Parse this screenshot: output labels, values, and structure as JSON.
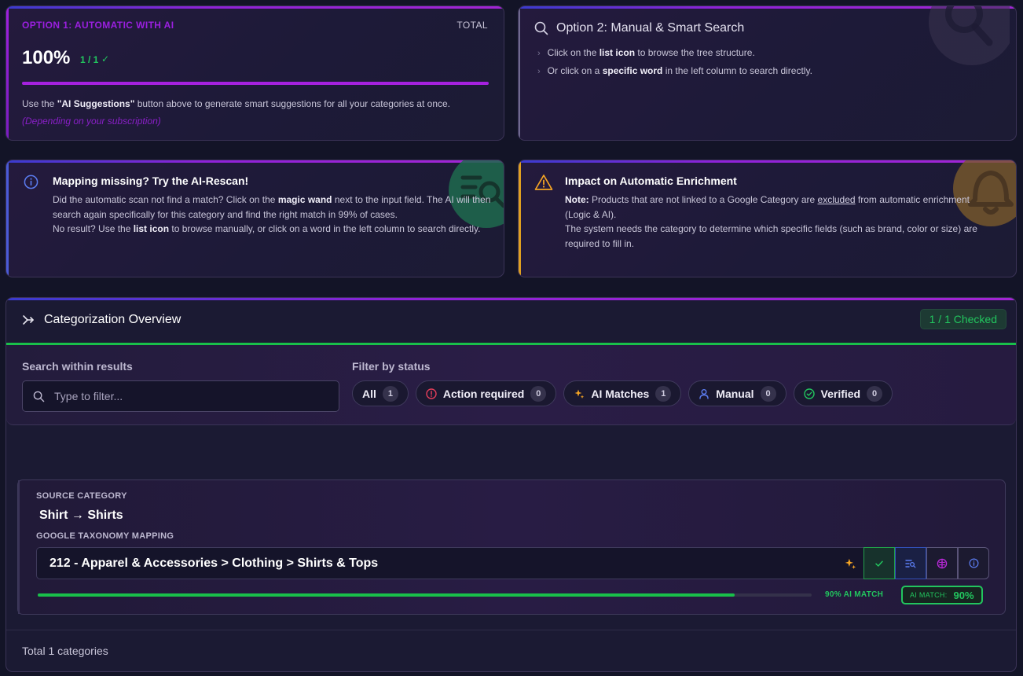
{
  "option1": {
    "title": "OPTION 1: AUTOMATIC WITH AI",
    "total_label": "TOTAL",
    "percent": "100%",
    "fraction": "1 / 1",
    "progress": 1.0,
    "desc_prefix": "Use the ",
    "desc_bold": "\"AI Suggestions\"",
    "desc_suffix": " button above to generate smart suggestions for all your categories at once.",
    "subnote": "(Depending on your subscription)"
  },
  "option2": {
    "title": "Option 2: Manual & Smart Search",
    "items": [
      {
        "pre": "Click on the ",
        "bold": "list icon",
        "post": " to browse the tree structure."
      },
      {
        "pre": "Or click on a ",
        "bold": "specific word",
        "post": " in the left column to search directly."
      }
    ]
  },
  "mapping_missing": {
    "title": "Mapping missing? Try the AI-Rescan!",
    "p1_pre": "Did the automatic scan not find a match? Click on the ",
    "p1_bold": "magic wand",
    "p1_post": "   next to the input field. The AI will then search again specifically for this category and find the right match in 99% of cases.",
    "p2_pre": "No result? Use the ",
    "p2_bold": "list icon",
    "p2_post": "   to browse manually, or click on a word in the left column to search directly."
  },
  "impact": {
    "title": "Impact on Automatic Enrichment",
    "note_label": "Note:",
    "note_pre": " Products that are not linked to a Google Category are ",
    "note_under": "excluded",
    "note_post": " from automatic enrichment (Logic & AI).",
    "p2": "The system needs the category to determine which specific fields (such as brand, color or size) are required to fill in."
  },
  "overview": {
    "title": "Categorization Overview",
    "checked_badge": "1 / 1 Checked",
    "search_label": "Search within results",
    "search_placeholder": "Type to filter...",
    "filter_label": "Filter by status",
    "filters": [
      {
        "label": "All",
        "count": "1",
        "icon": "none"
      },
      {
        "label": "Action required",
        "count": "0",
        "icon": "alert-circle-icon",
        "color": "#e53e5a"
      },
      {
        "label": "AI Matches",
        "count": "1",
        "icon": "sparkles-icon",
        "color": "#f5a524"
      },
      {
        "label": "Manual",
        "count": "0",
        "icon": "user-icon",
        "color": "#5b7cf0"
      },
      {
        "label": "Verified",
        "count": "0",
        "icon": "check-circle-icon",
        "color": "#22c55e"
      }
    ],
    "row": {
      "source_label": "SOURCE CATEGORY",
      "source_value": "Shirt → Shirts",
      "mapping_label": "GOOGLE TAXONOMY MAPPING",
      "mapping_value": "212 - Apparel & Accessories > Clothing > Shirts & Tops",
      "match_fraction": 0.9,
      "match_text": "90% AI MATCH",
      "badge_label": "AI MATCH:",
      "badge_value": "90%"
    },
    "footer": "Total 1 categories"
  },
  "colors": {
    "accent_purple": "#9b1fe0",
    "success_green": "#22c55e",
    "warning_amber": "#e0a020",
    "info_blue": "#4a5bd8"
  }
}
